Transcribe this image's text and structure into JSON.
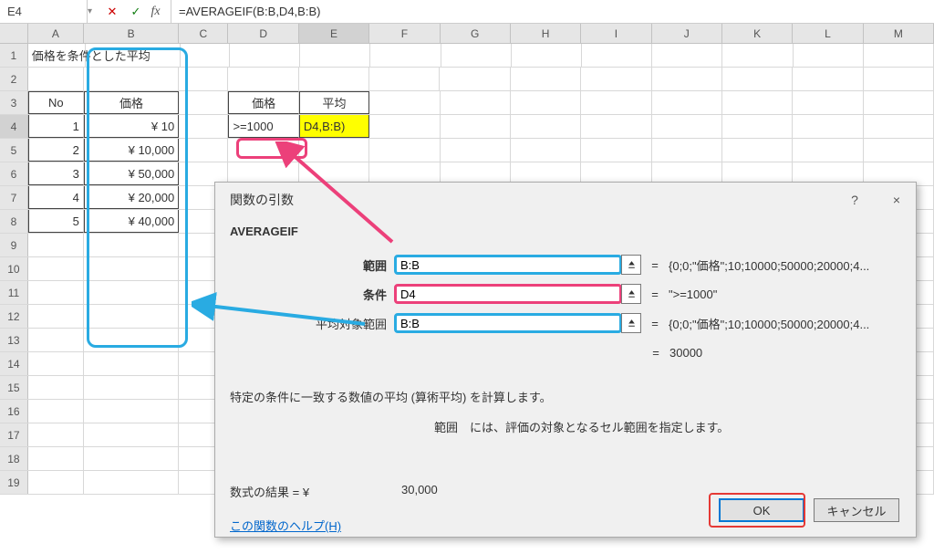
{
  "nameBox": "E4",
  "formula": "=AVERAGEIF(B:B,D4,B:B)",
  "cols": [
    "A",
    "B",
    "C",
    "D",
    "E",
    "F",
    "G",
    "H",
    "I",
    "J",
    "K",
    "L",
    "M"
  ],
  "rows": [
    "1",
    "2",
    "3",
    "4",
    "5",
    "6",
    "7",
    "8",
    "9",
    "10",
    "11",
    "12",
    "13",
    "14",
    "15",
    "16",
    "17",
    "18",
    "19"
  ],
  "sheet": {
    "A1": "価格を条件とした平均",
    "A3": "No",
    "B3": "価格",
    "A4": "1",
    "B4": "¥         10",
    "A5": "2",
    "B5": "¥ 10,000",
    "A6": "3",
    "B6": "¥ 50,000",
    "A7": "4",
    "B7": "¥ 20,000",
    "A8": "5",
    "B8": "¥ 40,000",
    "D3": "価格",
    "E3": "平均",
    "D4": ">=1000",
    "E4": "D4,B:B)"
  },
  "dialog": {
    "title": "関数の引数",
    "funcName": "AVERAGEIF",
    "arg1Label": "範囲",
    "arg1Value": "B:B",
    "arg1Result": "{0;0;\"価格\";10;10000;50000;20000;4...",
    "arg2Label": "条件",
    "arg2Value": "D4",
    "arg2Result": "\">=1000\"",
    "arg3Label": "平均対象範囲",
    "arg3Value": "B:B",
    "arg3Result": "{0;0;\"価格\";10;10000;50000;20000;4...",
    "finalResult": "30000",
    "desc1": "特定の条件に一致する数値の平均 (算術平均) を計算します。",
    "desc2": "範囲　には、評価の対象となるセル範囲を指定します。",
    "resultLabel": "数式の結果 = ",
    "resultCurrency": "¥",
    "resultValue": "30,000",
    "helpLink": "この関数のヘルプ(H)",
    "okBtn": "OK",
    "cancelBtn": "キャンセル",
    "help": "?",
    "close": "×"
  }
}
